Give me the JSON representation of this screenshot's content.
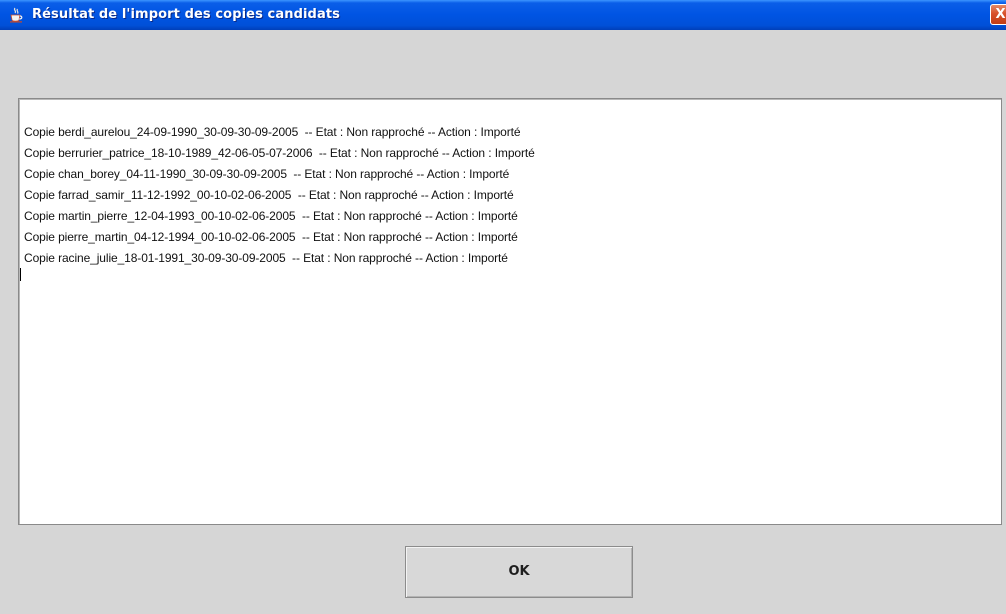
{
  "window": {
    "title": "Résultat de l'import des copies candidats",
    "close_glyph": "X",
    "icon": "java-cup-icon"
  },
  "log": {
    "lines": [
      "Copie berdi_aurelou_24-09-1990_30-09-30-09-2005  -- Etat : Non rapproché -- Action : Importé",
      "Copie berrurier_patrice_18-10-1989_42-06-05-07-2006  -- Etat : Non rapproché -- Action : Importé",
      "Copie chan_borey_04-11-1990_30-09-30-09-2005  -- Etat : Non rapproché -- Action : Importé",
      "Copie farrad_samir_11-12-1992_00-10-02-06-2005  -- Etat : Non rapproché -- Action : Importé",
      "Copie martin_pierre_12-04-1993_00-10-02-06-2005  -- Etat : Non rapproché -- Action : Importé",
      "Copie pierre_martin_04-12-1994_00-10-02-06-2005  -- Etat : Non rapproché -- Action : Importé",
      "Copie racine_julie_18-01-1991_30-09-30-09-2005  -- Etat : Non rapproché -- Action : Importé"
    ]
  },
  "buttons": {
    "ok_label": "OK"
  },
  "colors": {
    "titlebar": "#0054e3",
    "window_bg": "#d6d6d6",
    "text_area_bg": "#ffffff",
    "close_button": "#d8502b"
  }
}
